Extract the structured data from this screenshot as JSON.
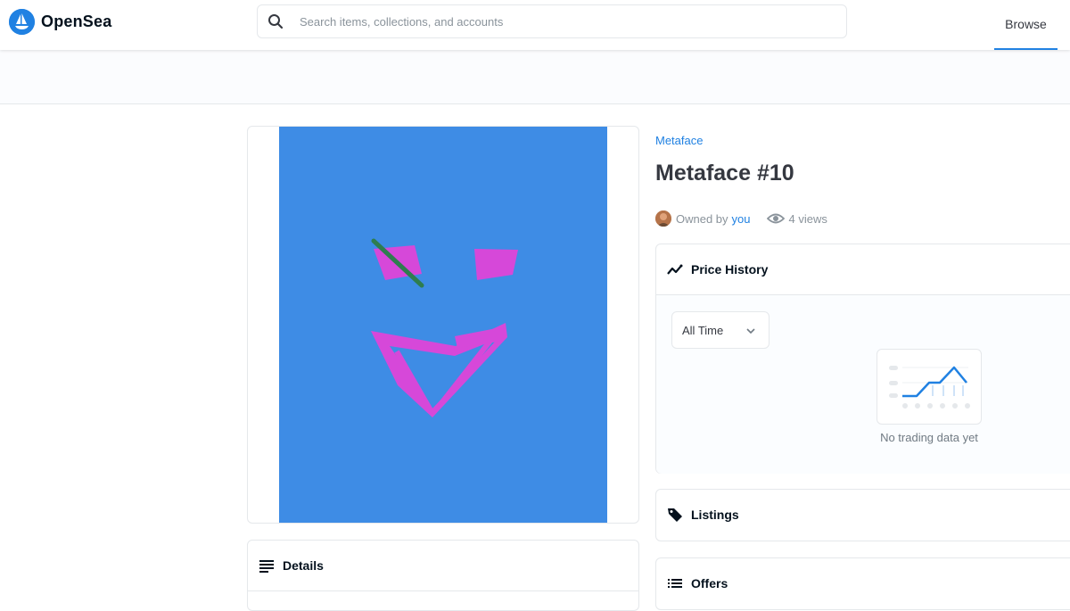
{
  "nav": {
    "logo_text": "OpenSea",
    "search_placeholder": "Search items, collections, and accounts",
    "browse_label": "Browse"
  },
  "item": {
    "collection": "Metaface",
    "title": "Metaface #10",
    "owned_by_label": "Owned by",
    "owner": "you",
    "views": "4 views"
  },
  "panels": {
    "details": "Details",
    "price_history": "Price History",
    "time_range": "All Time",
    "no_data": "No trading data yet",
    "listings": "Listings",
    "offers": "Offers"
  },
  "colors": {
    "accent": "#2081e2",
    "nft_background": "#3e8ce5",
    "nft_face": "#d648d9",
    "nft_stroke": "#2e7d4f"
  },
  "icons": [
    "search-icon",
    "opensea-logo-icon",
    "eye-icon",
    "trend-icon",
    "tag-icon",
    "list-icon",
    "chevron-down-icon"
  ]
}
